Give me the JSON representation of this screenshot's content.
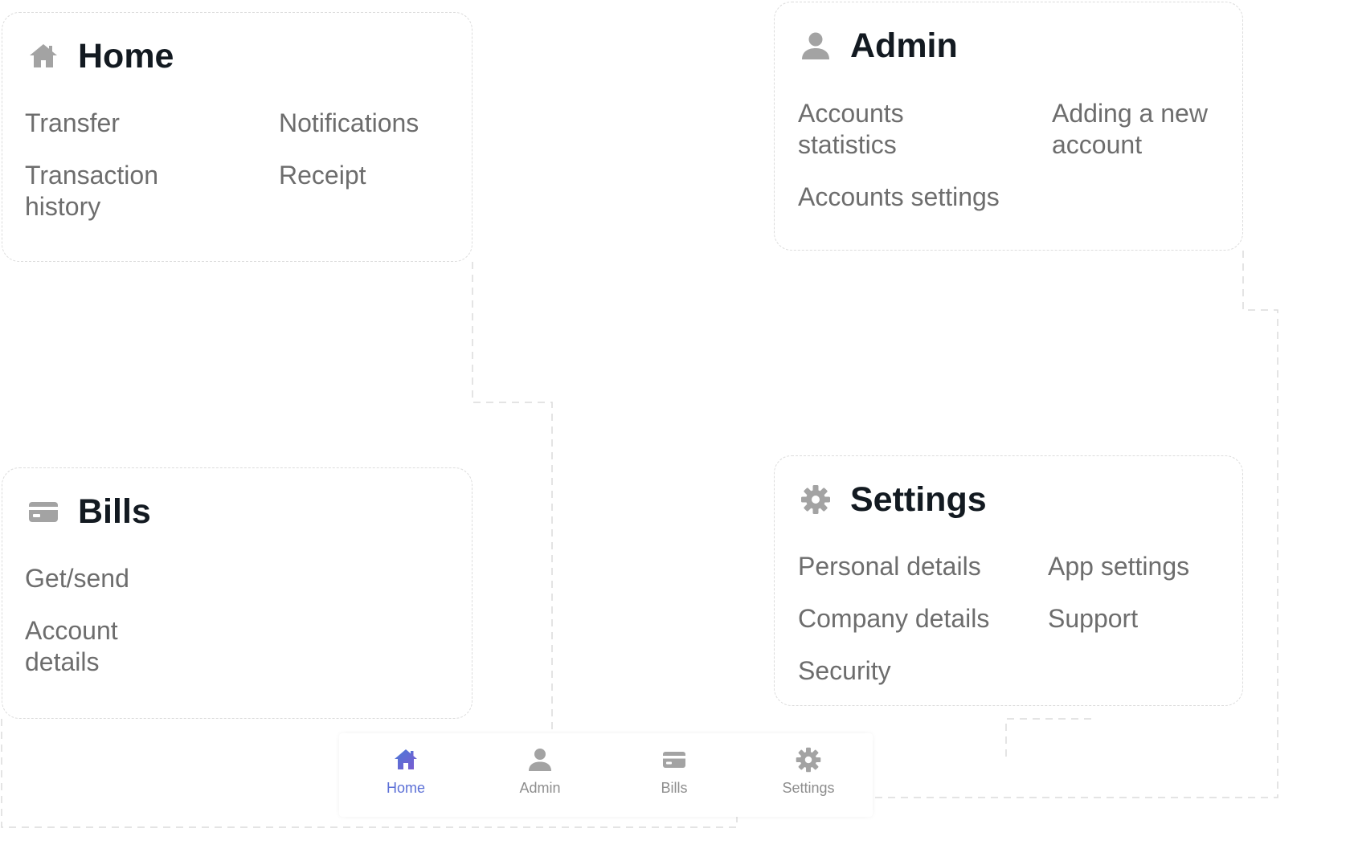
{
  "cards": {
    "home": {
      "title": "Home",
      "icon": "home-icon",
      "items": [
        "Transfer",
        "Notifications",
        "Transaction\nhistory",
        "Receipt"
      ]
    },
    "admin": {
      "title": "Admin",
      "icon": "user-icon",
      "items": [
        "Accounts\nstatistics",
        "Adding a new\naccount",
        "Accounts settings"
      ]
    },
    "bills": {
      "title": "Bills",
      "icon": "card-icon",
      "items": [
        "Get/send",
        "Account\ndetails"
      ]
    },
    "settings": {
      "title": "Settings",
      "icon": "gear-icon",
      "items": [
        "Personal details",
        "App settings",
        "Company details",
        "Support",
        "Security"
      ]
    }
  },
  "nav": {
    "active": "Home",
    "items": [
      {
        "label": "Home",
        "icon": "home-icon"
      },
      {
        "label": "Admin",
        "icon": "user-icon"
      },
      {
        "label": "Bills",
        "icon": "card-icon"
      },
      {
        "label": "Settings",
        "icon": "gear-icon"
      }
    ]
  },
  "colors": {
    "title": "#131a21",
    "item": "#6d6d6d",
    "icon": "#a3a3a3",
    "nav_active_start": "#4a7bd8",
    "nav_active_end": "#7c5ad0",
    "connector": "#dcdcdc"
  }
}
